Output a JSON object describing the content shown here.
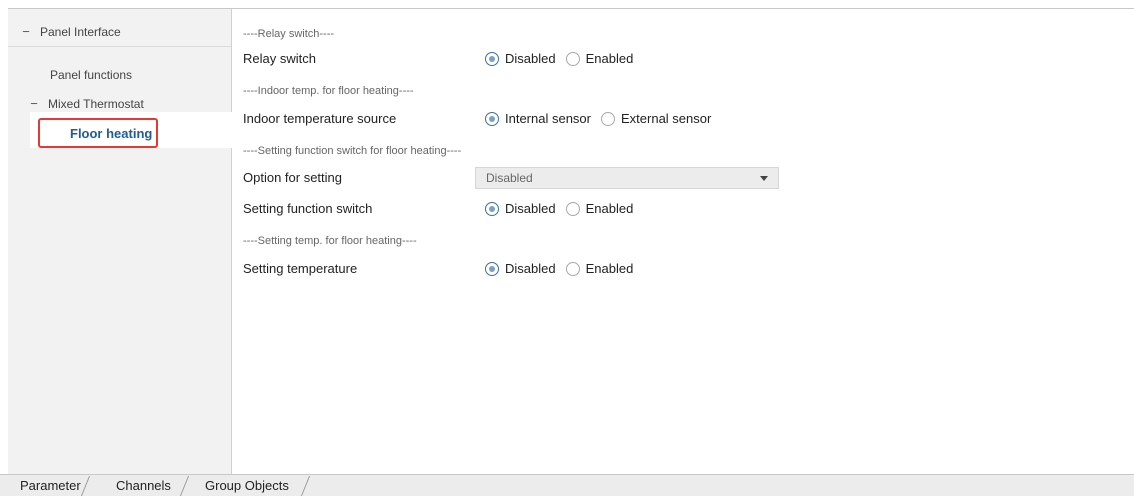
{
  "sidebar": {
    "items": [
      {
        "label": "Panel Interface",
        "toggle": "−"
      },
      {
        "label": "Panel functions"
      },
      {
        "label": "Mixed Thermostat",
        "toggle": "−"
      },
      {
        "label": "Floor heating",
        "selected": true
      }
    ]
  },
  "main": {
    "sections": [
      {
        "header": "----Relay switch----",
        "params": [
          {
            "label": "Relay switch",
            "type": "radio",
            "options": [
              "Disabled",
              "Enabled"
            ],
            "selected": "Disabled"
          }
        ]
      },
      {
        "header": "----Indoor temp. for floor heating----",
        "params": [
          {
            "label": "Indoor temperature source",
            "type": "radio",
            "options": [
              "Internal sensor",
              "External sensor"
            ],
            "selected": "Internal sensor"
          }
        ]
      },
      {
        "header": "----Setting function switch for floor heating----",
        "params": [
          {
            "label": "Option for setting",
            "type": "dropdown",
            "value": "Disabled"
          },
          {
            "label": "Setting function switch",
            "type": "radio",
            "options": [
              "Disabled",
              "Enabled"
            ],
            "selected": "Disabled"
          }
        ]
      },
      {
        "header": "----Setting temp. for floor heating----",
        "params": [
          {
            "label": "Setting temperature",
            "type": "radio",
            "options": [
              "Disabled",
              "Enabled"
            ],
            "selected": "Disabled"
          }
        ]
      }
    ]
  },
  "tabs": [
    {
      "label": "Parameter",
      "active": true
    },
    {
      "label": "Channels"
    },
    {
      "label": "Group Objects"
    }
  ],
  "colors": {
    "highlight_border": "#e53935",
    "selected_text": "#1f5e8e",
    "radio_on": "#7d9fc4"
  }
}
